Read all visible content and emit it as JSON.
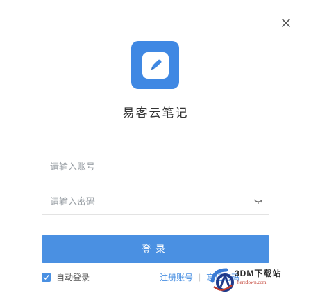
{
  "window": {
    "close_icon": "close-icon"
  },
  "app": {
    "logo_icon": "pen-icon",
    "logo_color": "#3f88e3",
    "title": "易客云笔记"
  },
  "form": {
    "account_placeholder": "请输入账号",
    "password_placeholder": "请输入密码",
    "password_toggle_icon": "eye-closed-icon",
    "login_label": "登录",
    "accent_color": "#4a90e2"
  },
  "options": {
    "remember_label": "自动登录",
    "remember_checked": true,
    "register_label": "注册账号",
    "forgot_label": "忘记密码"
  },
  "watermark": {
    "text": "3DM下载站",
    "url": "heredown.com"
  }
}
